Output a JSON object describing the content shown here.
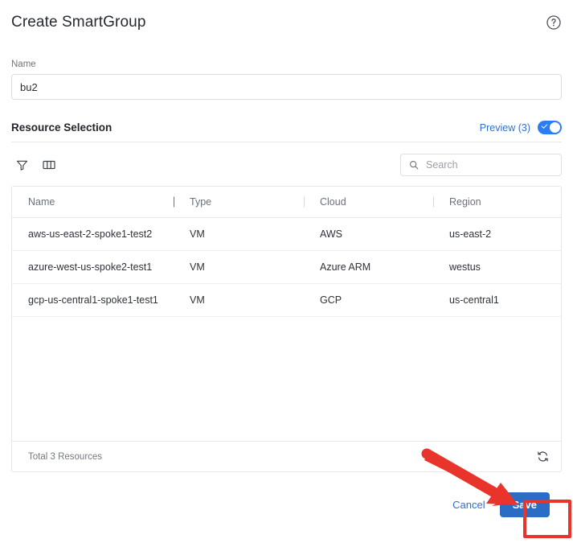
{
  "header": {
    "title": "Create SmartGroup",
    "help_icon": "help-circle-icon"
  },
  "name_field": {
    "label": "Name",
    "value": "bu2",
    "placeholder": ""
  },
  "resource_selection": {
    "title": "Resource Selection",
    "preview_label": "Preview (3)",
    "toggle_on": true
  },
  "toolbar": {
    "filter_icon": "filter-icon",
    "columns_icon": "columns-icon",
    "search": {
      "icon": "search-icon",
      "value": "",
      "placeholder": "Search"
    }
  },
  "table": {
    "columns": [
      {
        "key": "name",
        "label": "Name"
      },
      {
        "key": "type",
        "label": "Type"
      },
      {
        "key": "cloud",
        "label": "Cloud"
      },
      {
        "key": "region",
        "label": "Region"
      }
    ],
    "rows": [
      {
        "name": "aws-us-east-2-spoke1-test2",
        "type": "VM",
        "cloud": "AWS",
        "region": "us-east-2"
      },
      {
        "name": "azure-west-us-spoke2-test1",
        "type": "VM",
        "cloud": "Azure ARM",
        "region": "westus"
      },
      {
        "name": "gcp-us-central1-spoke1-test1",
        "type": "VM",
        "cloud": "GCP",
        "region": "us-central1"
      }
    ],
    "footer": {
      "total_text": "Total 3 Resources",
      "refresh_icon": "refresh-icon"
    }
  },
  "actions": {
    "cancel_label": "Cancel",
    "save_label": "Save"
  },
  "annotation": {
    "arrow_color": "#e8342a",
    "highlight_color": "#e8342a",
    "points_to": "Save"
  },
  "colors": {
    "accent_blue": "#2b6cc4",
    "link_blue": "#2f6fd0",
    "toggle_blue": "#2b7cf5",
    "annotation_red": "#e8342a",
    "border_gray": "#e5e7ea",
    "text_dark": "#2e323a",
    "text_muted": "#6b7079"
  }
}
